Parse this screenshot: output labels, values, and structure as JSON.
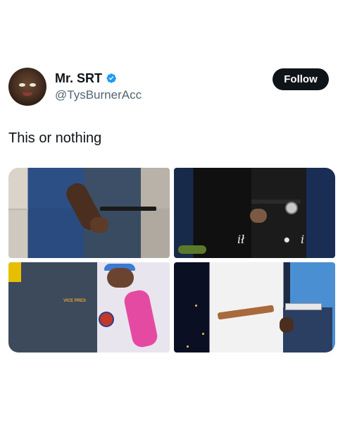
{
  "author": {
    "display_name": "Mr. SRT",
    "handle": "@TysBurnerAcc",
    "verified": true,
    "verified_color": "#1d9bf0"
  },
  "follow_button": {
    "label": "Follow"
  },
  "post": {
    "text": "This or nothing"
  },
  "media": {
    "photos": [
      {
        "position": "top-left"
      },
      {
        "position": "top-right",
        "sign_text": "ił",
        "sign_text_2": "i"
      },
      {
        "position": "bottom-left",
        "shirt_text": "VICE PRES"
      },
      {
        "position": "bottom-right"
      }
    ]
  }
}
